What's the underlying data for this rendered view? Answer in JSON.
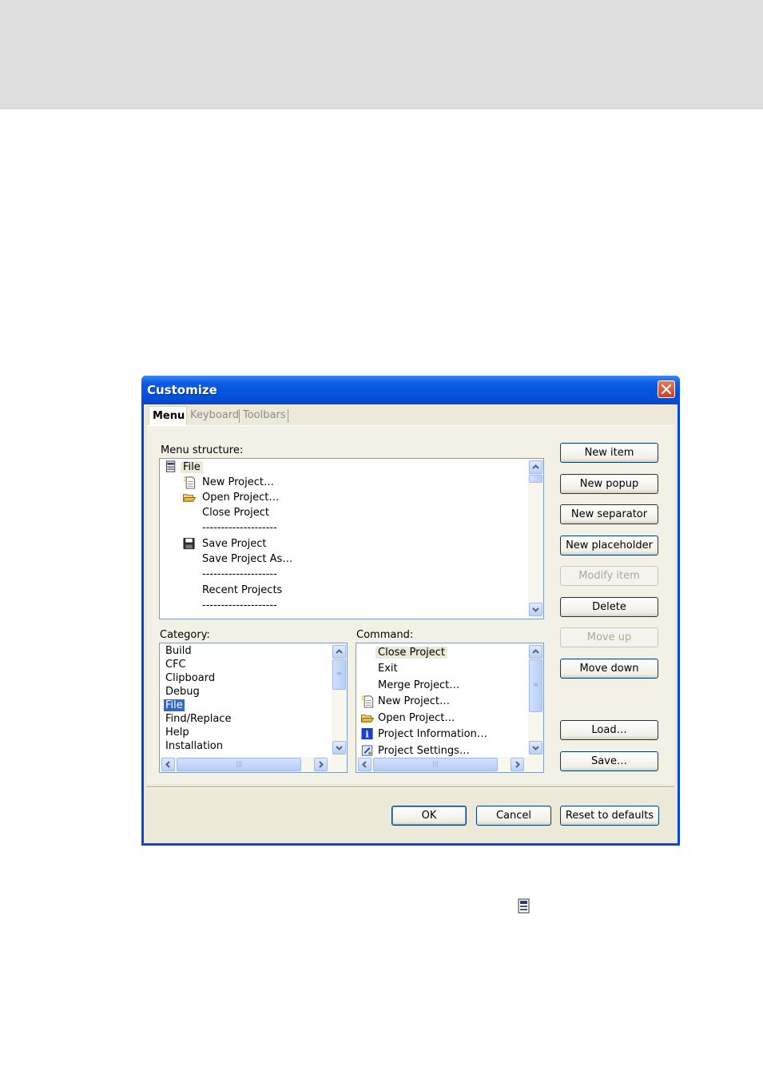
{
  "dialog": {
    "title": "Customize",
    "tabs": [
      "Menu",
      "Keyboard",
      "Toolbars"
    ]
  },
  "menu_structure": {
    "label": "Menu structure:",
    "items": [
      {
        "text": "File",
        "icon": "menu-folder-icon"
      },
      {
        "text": "New Project…",
        "icon": "new-document-icon"
      },
      {
        "text": "Open Project…",
        "icon": "open-folder-icon"
      },
      {
        "text": "Close Project",
        "icon": ""
      },
      {
        "text": "--------------------",
        "icon": ""
      },
      {
        "text": "Save Project",
        "icon": "floppy-disk-icon"
      },
      {
        "text": "Save Project As…",
        "icon": ""
      },
      {
        "text": "--------------------",
        "icon": ""
      },
      {
        "text": "Recent Projects",
        "icon": ""
      },
      {
        "text": "--------------------",
        "icon": ""
      }
    ]
  },
  "category": {
    "label": "Category:",
    "items": [
      "Build",
      "CFC",
      "Clipboard",
      "Debug",
      "File",
      "Find/Replace",
      "Help",
      "Installation"
    ],
    "selected": "File"
  },
  "command": {
    "label": "Command:",
    "items": [
      {
        "text": "Close Project",
        "icon": ""
      },
      {
        "text": "Exit",
        "icon": ""
      },
      {
        "text": "Merge Project…",
        "icon": ""
      },
      {
        "text": "New Project…",
        "icon": "new-document-icon"
      },
      {
        "text": "Open Project…",
        "icon": "open-folder-icon"
      },
      {
        "text": "Project Information…",
        "icon": "info-icon"
      },
      {
        "text": "Project Settings…",
        "icon": "settings-icon"
      }
    ]
  },
  "side_buttons": {
    "new_item": "New item",
    "new_popup": "New popup",
    "new_separator": "New separator",
    "new_placeholder": "New placeholder",
    "modify_item": "Modify item",
    "delete": "Delete",
    "move_up": "Move up",
    "move_down": "Move down",
    "load": "Load…",
    "save": "Save…"
  },
  "footer_buttons": {
    "ok": "OK",
    "cancel": "Cancel",
    "reset": "Reset to defaults"
  },
  "colors": {
    "title_bar": "#0351d9",
    "selection": "#316ac5",
    "dialog_face": "#ece9d8"
  }
}
